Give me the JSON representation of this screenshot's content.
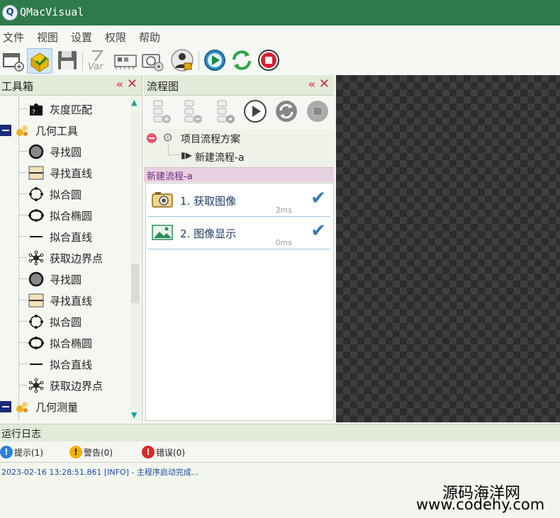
{
  "app": {
    "title": "QMacVisual"
  },
  "menu": {
    "items": [
      "文件",
      "视图",
      "设置",
      "权限",
      "帮助"
    ]
  },
  "toolbar": {
    "var_label": "Var"
  },
  "toolbox": {
    "title": "工具箱",
    "items": [
      {
        "label": "灰度匹配",
        "icon": "puzzle-icon"
      },
      {
        "label": "几何工具",
        "icon": "group-icon",
        "group": true
      },
      {
        "label": "寻找圆",
        "icon": "find-circle-icon"
      },
      {
        "label": "寻找直线",
        "icon": "find-line-icon"
      },
      {
        "label": "拟合圆",
        "icon": "fit-circle-icon"
      },
      {
        "label": "拟合椭圆",
        "icon": "fit-ellipse-icon"
      },
      {
        "label": "拟合直线",
        "icon": "fit-line-icon"
      },
      {
        "label": "获取边界点",
        "icon": "edge-points-icon"
      },
      {
        "label": "寻找圆",
        "icon": "find-circle-icon"
      },
      {
        "label": "寻找直线",
        "icon": "find-line-icon"
      },
      {
        "label": "拟合圆",
        "icon": "fit-circle-icon"
      },
      {
        "label": "拟合椭圆",
        "icon": "fit-ellipse-icon"
      },
      {
        "label": "拟合直线",
        "icon": "fit-line-icon"
      },
      {
        "label": "获取边界点",
        "icon": "edge-points-icon"
      },
      {
        "label": "几何测量",
        "icon": "group-icon",
        "group": true
      }
    ]
  },
  "flow": {
    "title": "流程图",
    "project_label": "项目流程方案",
    "sub_label": "新建流程-a",
    "active_flow": "新建流程-a",
    "steps": [
      {
        "name": "1. 获取图像",
        "time": "3ms",
        "icon": "camera-icon"
      },
      {
        "name": "2. 图像显示",
        "time": "0ms",
        "icon": "image-icon"
      }
    ]
  },
  "log": {
    "title": "运行日志",
    "tabs": [
      {
        "label": "提示(1)",
        "color": "#2d7fd8"
      },
      {
        "label": "警告(0)",
        "color": "#f0b000"
      },
      {
        "label": "错误(0)",
        "color": "#d82a2a"
      }
    ],
    "entries": [
      "2023-02-16 13:28:51.861 [INFO]  -   主程序启动完成..."
    ]
  },
  "watermark": {
    "line1": "源码海洋网",
    "line2": "www.codehy.com"
  }
}
